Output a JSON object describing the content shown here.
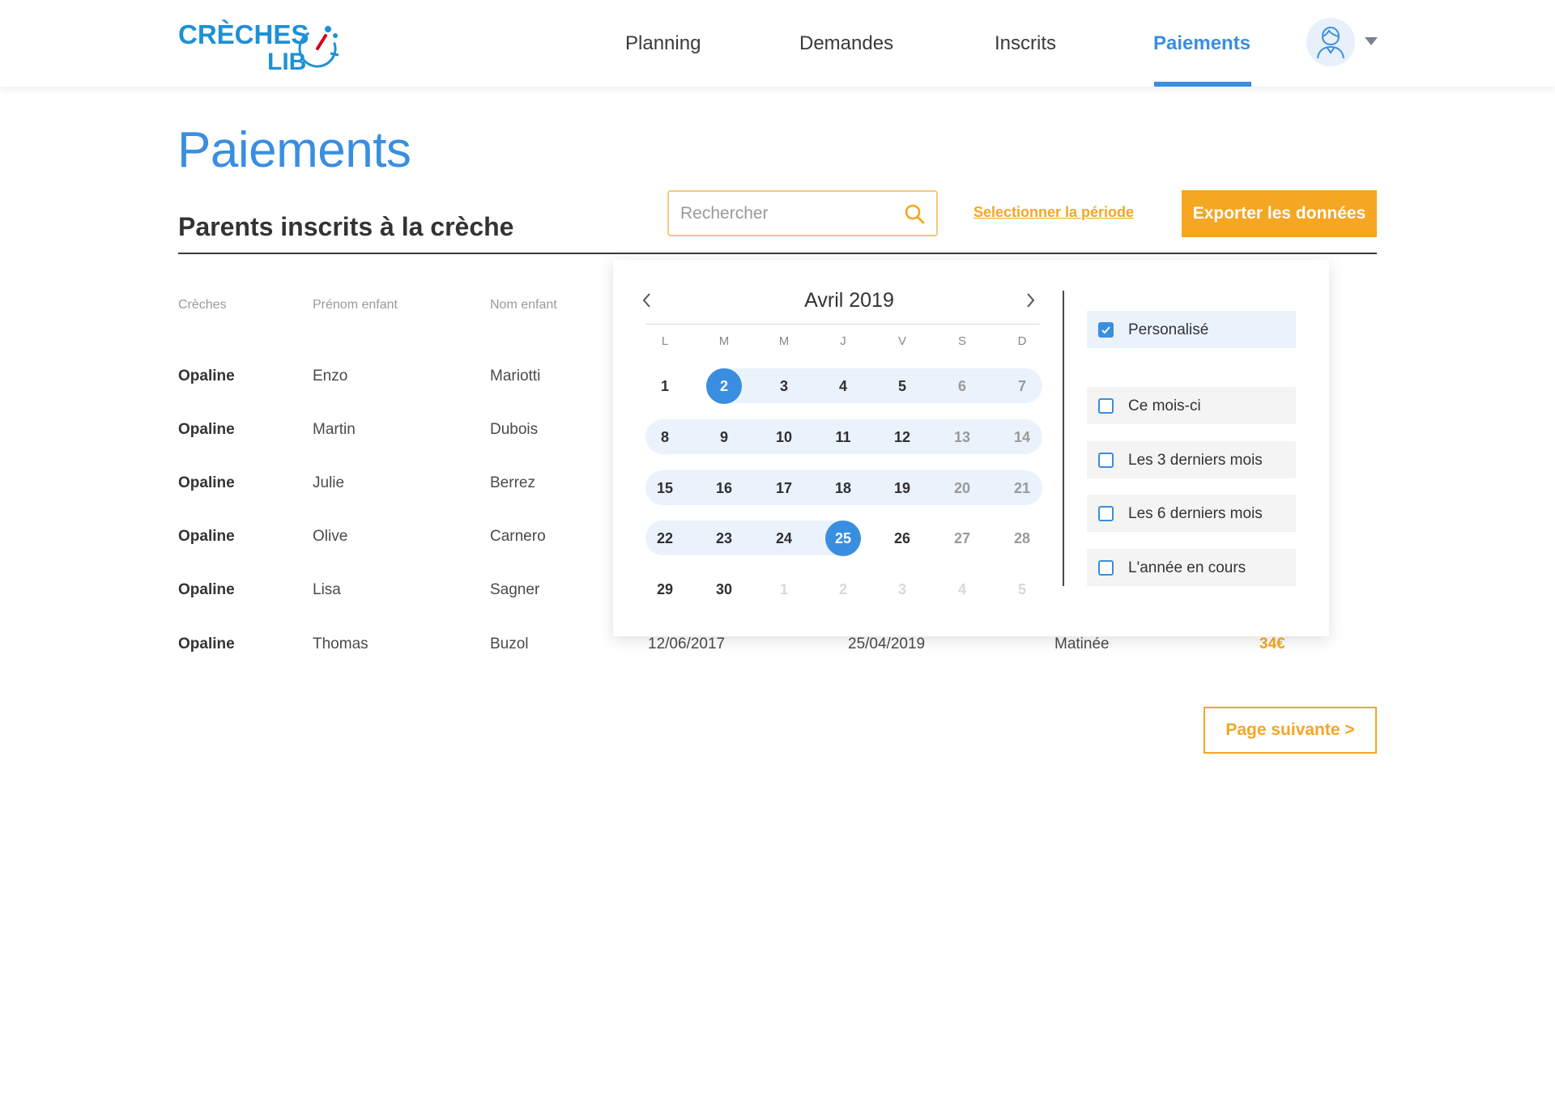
{
  "brand": {
    "line1": "CRÈCHES",
    "line2": "LIB",
    "color": "#1e90d6"
  },
  "colors": {
    "accent_blue": "#3a8ee0",
    "accent_orange": "#f5a623"
  },
  "nav": {
    "items": [
      {
        "label": "Planning",
        "active": false
      },
      {
        "label": "Demandes",
        "active": false
      },
      {
        "label": "Inscrits",
        "active": false
      },
      {
        "label": "Paiements",
        "active": true
      }
    ],
    "avatar_icon": "user-avatar-icon"
  },
  "page": {
    "title": "Paiements",
    "section_title": "Parents inscrits à la crèche",
    "search_placeholder": "Rechercher",
    "period_link": "Selectionner la période",
    "export_label": "Exporter les données",
    "next_label": "Page suivante >"
  },
  "table": {
    "columns": [
      "Crèches",
      "Prénom enfant",
      "Nom enfant"
    ],
    "rows": [
      {
        "creche": "Opaline",
        "prenom": "Enzo",
        "nom": "Mariotti"
      },
      {
        "creche": "Opaline",
        "prenom": "Martin",
        "nom": "Dubois"
      },
      {
        "creche": "Opaline",
        "prenom": "Julie",
        "nom": "Berrez"
      },
      {
        "creche": "Opaline",
        "prenom": "Olive",
        "nom": "Carnero"
      },
      {
        "creche": "Opaline",
        "prenom": "Lisa",
        "nom": "Sagner"
      },
      {
        "creche": "Opaline",
        "prenom": "Thomas",
        "nom": "Buzol",
        "date1": "12/06/2017",
        "date2": "25/04/2019",
        "slot": "Matinée",
        "amount": "34€"
      }
    ]
  },
  "calendar": {
    "month_label": "Avril 2019",
    "weekdays": [
      "L",
      "M",
      "M",
      "J",
      "V",
      "S",
      "D"
    ],
    "weeks": [
      [
        "1",
        "2",
        "3",
        "4",
        "5",
        "6",
        "7"
      ],
      [
        "8",
        "9",
        "10",
        "11",
        "12",
        "13",
        "14"
      ],
      [
        "15",
        "16",
        "17",
        "18",
        "19",
        "20",
        "21"
      ],
      [
        "22",
        "23",
        "24",
        "25",
        "26",
        "27",
        "28"
      ],
      [
        "29",
        "30",
        "1",
        "2",
        "3",
        "4",
        "5"
      ]
    ],
    "range_start": "2",
    "range_end": "25",
    "options": [
      {
        "label": "Personalisé",
        "checked": true
      },
      {
        "label": "Ce mois-ci",
        "checked": false
      },
      {
        "label": "Les 3 derniers mois",
        "checked": false
      },
      {
        "label": "Les 6 derniers mois",
        "checked": false
      },
      {
        "label": "L'année en cours",
        "checked": false
      }
    ]
  }
}
